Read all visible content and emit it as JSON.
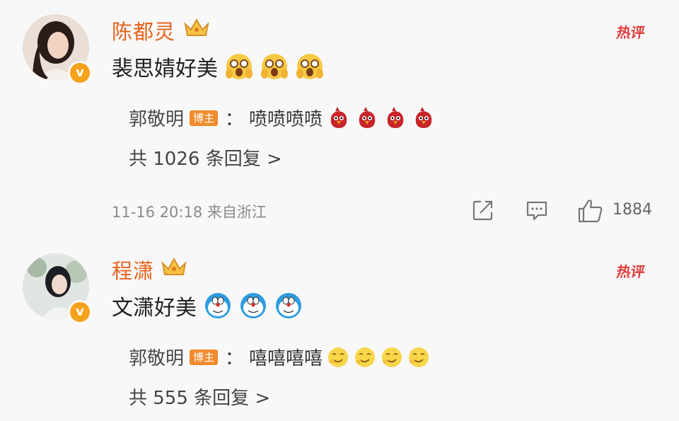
{
  "comments": [
    {
      "username": "陈都灵",
      "hot_label": "热评",
      "text": "裴思婧好美",
      "reply": {
        "author": "郭敬明",
        "badge": "博主",
        "colon": "：",
        "text": "喷喷喷喷"
      },
      "reply_count": "共 1026 条回复 >",
      "meta": "11-16 20:18 来自浙江",
      "like_count": "1884"
    },
    {
      "username": "程潇",
      "hot_label": "热评",
      "text": "文潇好美",
      "reply": {
        "author": "郭敬明",
        "badge": "博主",
        "colon": "：",
        "text": "嘻嘻嘻嘻"
      },
      "reply_count": "共 555 条回复 >"
    }
  ],
  "colors": {
    "username": "#e8631c",
    "hot": "#e03b3b",
    "badge": "#f28b2c",
    "verified": "#f7a21b"
  }
}
